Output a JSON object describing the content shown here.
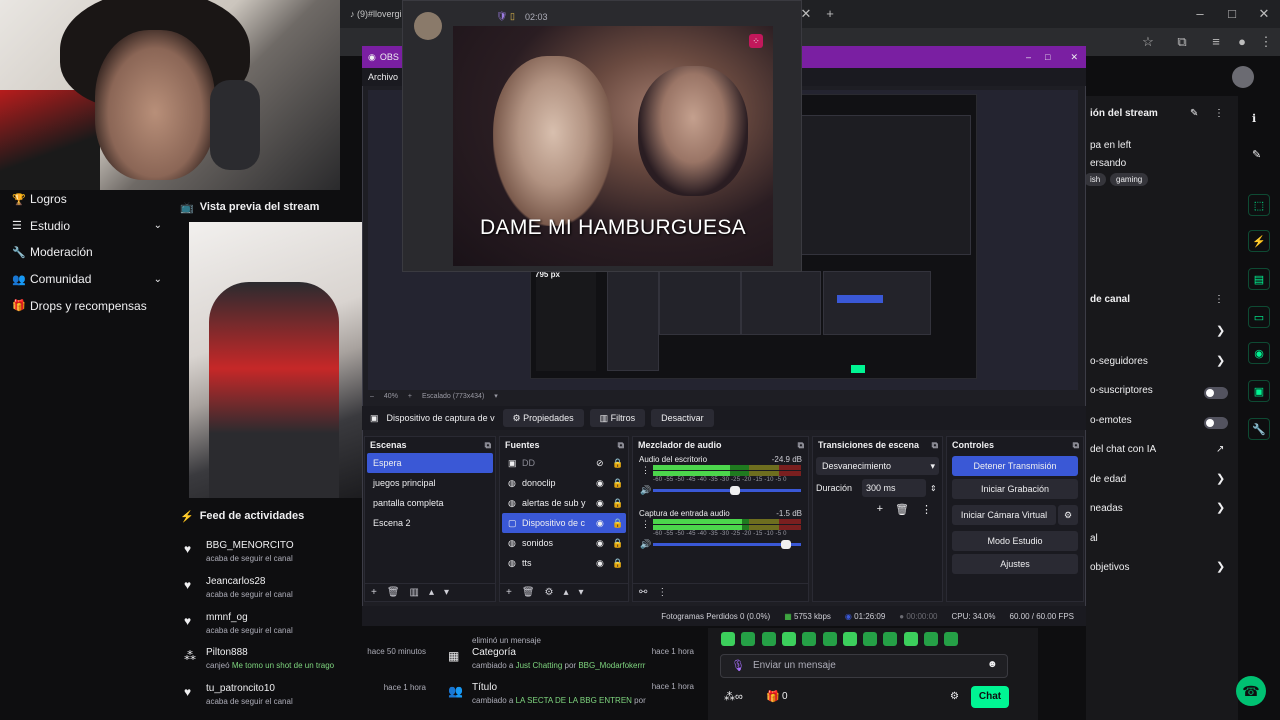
{
  "browser": {
    "tab_title": "(9)#llovergi",
    "controls": [
      "–",
      "□",
      "✕"
    ],
    "new_tab": "+",
    "close_tab": "✕"
  },
  "sidebar": {
    "items": [
      {
        "label": "Logros",
        "icon": "trophy-icon",
        "glyph": "🏆",
        "chevron": false
      },
      {
        "label": "Estudio",
        "icon": "list-icon",
        "glyph": "☰",
        "chevron": true
      },
      {
        "label": "Moderación",
        "icon": "wrench-icon",
        "glyph": "🔧",
        "chevron": false
      },
      {
        "label": "Comunidad",
        "icon": "people-icon",
        "glyph": "👥",
        "chevron": true
      },
      {
        "label": "Drops y recompensas",
        "icon": "gift-icon",
        "glyph": "🎁",
        "chevron": false
      }
    ]
  },
  "preview": {
    "title": "Vista previa del stream"
  },
  "feed": {
    "title": "Feed de actividades",
    "items": [
      {
        "name": "BBG_MENORCITO",
        "sub": "acaba de seguir el canal",
        "time": "",
        "icon": "heart-icon"
      },
      {
        "name": "Jeancarlos28",
        "sub": "acaba de seguir el canal",
        "time": "",
        "icon": "heart-icon"
      },
      {
        "name": "mmnf_og",
        "sub": "acaba de seguir el canal",
        "time": "",
        "icon": "heart-icon"
      },
      {
        "name": "Pilton888",
        "sub_prefix": "canjeó",
        "sub_highlight": "Me tomo un shot de un trago",
        "time": "hace 50 minutos",
        "icon": "points-icon"
      },
      {
        "name": "tu_patroncito10",
        "sub": "acaba de seguir el canal",
        "time": "hace 1 hora",
        "icon": "heart-icon"
      }
    ],
    "col2": [
      {
        "name": "",
        "sub": "eliminó un mensaje",
        "time": ""
      },
      {
        "name": "Categoría",
        "sub_prefix": "cambiado a",
        "sub_highlight": "Just Chatting",
        "sub_mid": "por",
        "sub_highlight2": "BBG_Modarfokerrr",
        "time": "hace 1 hora"
      },
      {
        "name": "Título",
        "sub_prefix": "cambiado a",
        "sub_highlight": "LA SECTA DE LA BBG ENTREN",
        "sub_mid": "por",
        "time": "hace 1 hora"
      }
    ]
  },
  "right_panel": {
    "stream_info_title": "ión del stream",
    "lines": [
      "pa en left",
      "ersando"
    ],
    "tags": [
      "ish",
      "gaming"
    ],
    "channel_title": "de canal",
    "settings": [
      {
        "label": "",
        "control": "chevron"
      },
      {
        "label": "o-seguidores",
        "control": "chevron"
      },
      {
        "label": "o-suscriptores",
        "control": "toggle"
      },
      {
        "label": "o-emotes",
        "control": "toggle"
      },
      {
        "label": "del chat con IA",
        "control": "external"
      },
      {
        "label": "de edad",
        "control": "chevron"
      },
      {
        "label": "neadas",
        "control": "chevron"
      },
      {
        "label": "al",
        "control": "none"
      },
      {
        "label": "objetivos",
        "control": "chevron"
      }
    ]
  },
  "obs": {
    "title": "OBS",
    "menu": "Archivo",
    "zoom": "40%",
    "scale": "Escalado (773x434)",
    "nested_px": "795 px",
    "source_bar": {
      "selected_source": "Dispositivo de captura de v",
      "properties": "Propiedades",
      "filters": "Filtros",
      "deactivate": "Desactivar"
    },
    "scenes": {
      "title": "Escenas",
      "items": [
        "Espera",
        "juegos principal",
        "pantalla completa",
        "Escena 2"
      ],
      "selected": 0
    },
    "sources": {
      "title": "Fuentes",
      "items": [
        {
          "label": "DD",
          "icon": "group-icon",
          "visible": false
        },
        {
          "label": "donoclip",
          "icon": "globe-icon",
          "visible": true
        },
        {
          "label": "alertas de sub y",
          "icon": "globe-icon",
          "visible": true
        },
        {
          "label": "Dispositivo de c",
          "icon": "camera-icon",
          "visible": true
        },
        {
          "label": "sonidos",
          "icon": "globe-icon",
          "visible": true
        },
        {
          "label": "tts",
          "icon": "globe-icon",
          "visible": true
        }
      ],
      "selected": 3
    },
    "mixer": {
      "title": "Mezclador de audio",
      "channels": [
        {
          "label": "Audio del escritorio",
          "db": "-24.9 dB",
          "level": 0.52,
          "volume": 0.56
        },
        {
          "label": "Captura de entrada audio",
          "db": "-1.5 dB",
          "level": 0.6,
          "volume": 0.93
        }
      ],
      "scale": "-60 -55 -50 -45 -40 -35 -30 -25 -20 -15 -10 -5 0"
    },
    "transitions": {
      "title": "Transiciones de escena",
      "selected": "Desvanecimiento",
      "duration_label": "Duración",
      "duration_value": "300 ms"
    },
    "controls": {
      "title": "Controles",
      "buttons": [
        "Detener Transmisión",
        "Iniciar Grabación",
        "Iniciar Cámara Virtual",
        "Modo Estudio",
        "Ajustes"
      ]
    },
    "status": {
      "frames": "Fotogramas Perdidos 0 (0.0%)",
      "bitrate": "5753 kbps",
      "live_time": "01:26:09",
      "rec_time": "00:00:00",
      "cpu": "CPU: 34.0%",
      "fps": "60.00 / 60.00 FPS"
    }
  },
  "popup": {
    "time": "02:03",
    "caption": "DAME MI HAMBURGUESA"
  },
  "chat": {
    "placeholder": "Enviar un mensaje",
    "points": "0",
    "send": "Chat"
  },
  "colors": {
    "obs_title": "#7a1fa2",
    "obs_accent": "#3a58d6",
    "twitch_green": "#00f593"
  }
}
